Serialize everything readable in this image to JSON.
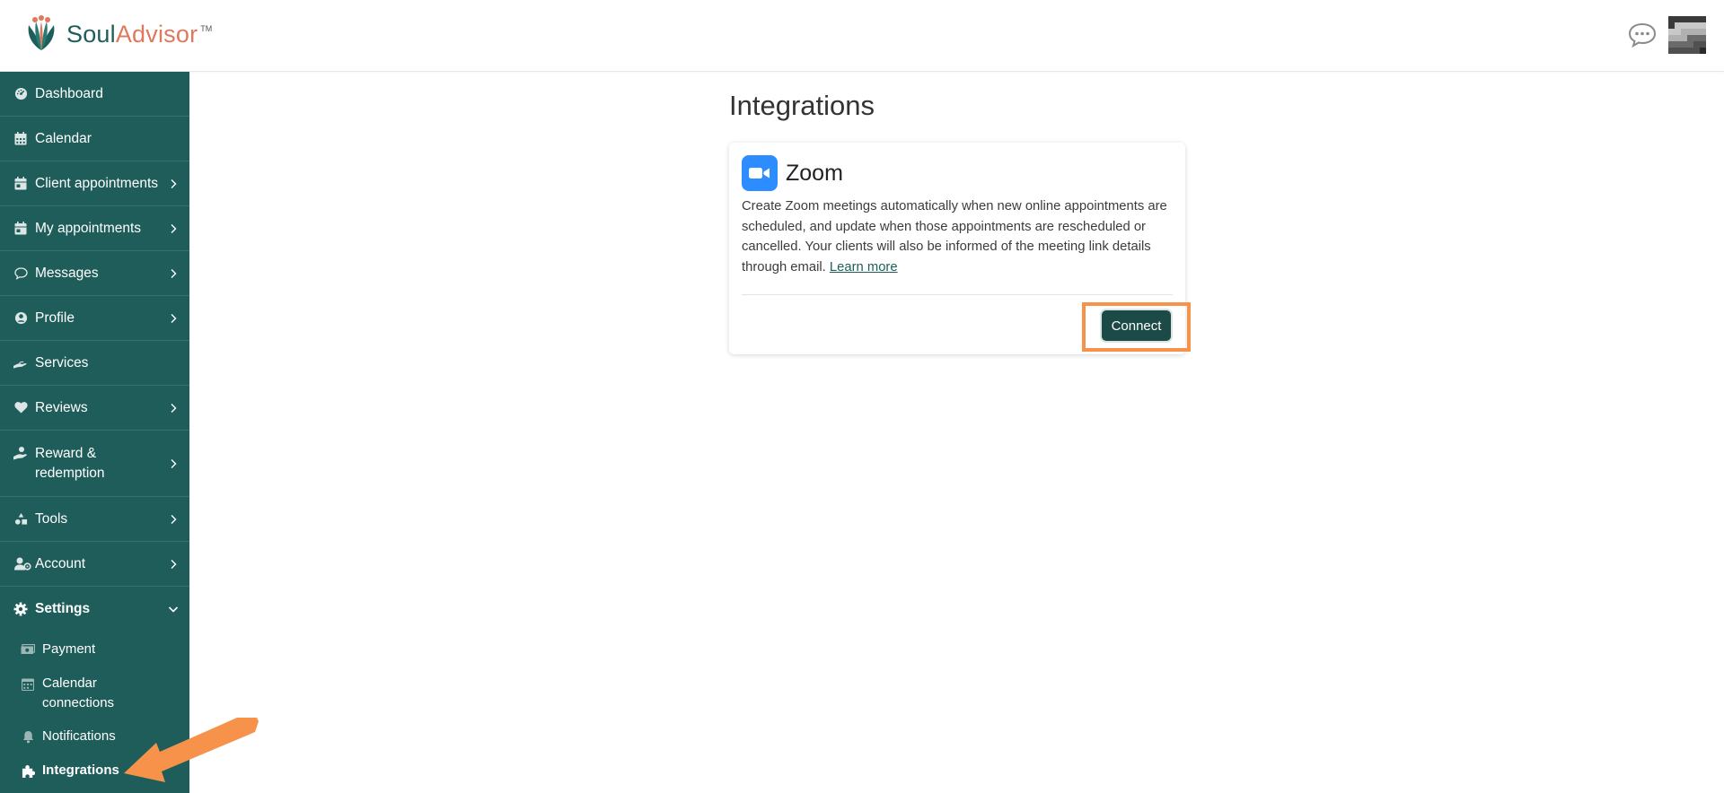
{
  "header": {
    "logo_soul": "Soul",
    "logo_advisor": "Advisor",
    "logo_tm": "TM",
    "chat_icon": "chat-bubble-icon",
    "avatar_icon": "user-avatar"
  },
  "sidebar": {
    "items": [
      {
        "label": "Dashboard",
        "icon": "dashboard-icon"
      },
      {
        "label": "Calendar",
        "icon": "calendar-icon"
      },
      {
        "label": "Client appointments",
        "icon": "calendar-check-icon"
      },
      {
        "label": "My appointments",
        "icon": "calendar-check-icon"
      },
      {
        "label": "Messages",
        "icon": "messages-icon"
      },
      {
        "label": "Profile",
        "icon": "user-circle-icon"
      },
      {
        "label": "Services",
        "icon": "hand-icon"
      },
      {
        "label": "Reviews",
        "icon": "heart-icon"
      },
      {
        "label": "Reward & redemption",
        "icon": "hand-gift-icon"
      },
      {
        "label": "Tools",
        "icon": "shapes-icon"
      },
      {
        "label": "Account",
        "icon": "user-cog-icon"
      },
      {
        "label": "Settings",
        "icon": "gear-icon"
      }
    ],
    "settings_sub": [
      {
        "label": "Payment",
        "icon": "money-icon"
      },
      {
        "label": "Calendar connections",
        "icon": "calendar-icon"
      },
      {
        "label": "Notifications",
        "icon": "bell-icon"
      },
      {
        "label": "Integrations",
        "icon": "puzzle-icon"
      }
    ]
  },
  "main": {
    "title": "Integrations",
    "zoom_card": {
      "title": "Zoom",
      "description": "Create Zoom meetings automatically when new online appointments are scheduled, and update when those appointments are rescheduled or cancelled. Your clients will also be informed of the meeting link details through email.",
      "learn_more": "Learn more",
      "connect": "Connect"
    }
  },
  "colors": {
    "sidebar_bg": "#1f5d5b",
    "button_bg": "#1c4a47",
    "zoom_blue": "#2d8cff",
    "annotation": "#f7924a",
    "logo_teal": "#1e5e5a",
    "logo_coral": "#e0785e"
  }
}
